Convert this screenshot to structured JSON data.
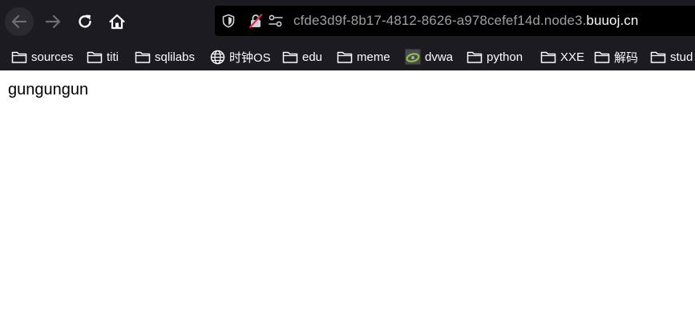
{
  "toolbar": {
    "back_icon": "arrow-left-icon",
    "forward_icon": "arrow-right-icon",
    "reload_icon": "reload-icon",
    "home_icon": "home-icon"
  },
  "urlbar": {
    "url_prefix": "cfde3d9f-8b17-4812-8626-a978cefef14d.node3.",
    "url_domain": "buuoj.cn",
    "security_icon": "shield-icon",
    "insecure_icon": "lock-slashed-icon",
    "permissions_icon": "permissions-icon"
  },
  "bookmarks": [
    {
      "label": "sources",
      "icon": "folder-icon"
    },
    {
      "label": "titi",
      "icon": "folder-icon"
    },
    {
      "label": "sqlilabs",
      "icon": "folder-icon"
    },
    {
      "label": "时钟OS",
      "icon": "globe-icon"
    },
    {
      "label": "edu",
      "icon": "folder-icon"
    },
    {
      "label": "meme",
      "icon": "folder-icon"
    },
    {
      "label": "dvwa",
      "icon": "site-favicon"
    },
    {
      "label": "python",
      "icon": "folder-icon"
    },
    {
      "label": "XXE",
      "icon": "folder-icon"
    },
    {
      "label": "解码",
      "icon": "folder-icon"
    },
    {
      "label": "stud",
      "icon": "folder-icon"
    }
  ],
  "page": {
    "text": "gungungun"
  },
  "colors": {
    "toolbar_bg": "#1c1b22",
    "urlbar_bg": "#000000",
    "page_bg": "#ffffff"
  }
}
